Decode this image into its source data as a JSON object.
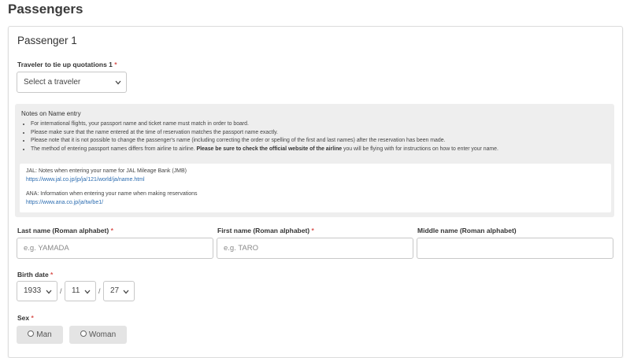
{
  "page_title": "Passengers",
  "card_title": "Passenger 1",
  "traveler": {
    "label": "Traveler to tie up quotations 1",
    "required_mark": "*",
    "selected": "Select a traveler"
  },
  "notes": {
    "title": "Notes on Name entry",
    "items": [
      "For international flights, your passport name and ticket name must match in order to board.",
      "Please make sure that the name entered at the time of reservation matches the passport name exactly.",
      "Please note that it is not possible to change the passenger's name (including correcting the order or spelling of the first and last names) after the reservation has been made."
    ],
    "item4_prefix": "The method of entering passport names differs from airline to airline. ",
    "item4_bold": "Please be sure to check the official website of the airline",
    "item4_suffix": " you will be flying with for instructions on how to enter your name.",
    "jal_head": "JAL: Notes when entering your name for JAL Mileage Bank (JMB)",
    "jal_url": "https://www.jal.co.jp/jp/ja/121/world/ja/name.html",
    "ana_head": "ANA: Information when entering your name when making reservations",
    "ana_url": "https://www.ana.co.jp/ja/tw/be1/"
  },
  "name_fields": {
    "last_label": "Last name (Roman alphabet)",
    "last_placeholder": "e.g. YAMADA",
    "first_label": "First name (Roman alphabet)",
    "first_placeholder": "e.g. TARO",
    "middle_label": "Middle name (Roman alphabet)",
    "middle_placeholder": "",
    "required_mark": "*"
  },
  "birth_date": {
    "label": "Birth date",
    "required_mark": "*",
    "year": "1933",
    "month": "11",
    "day": "27",
    "separator": "/"
  },
  "sex": {
    "label": "Sex",
    "required_mark": "*",
    "options": [
      "Man",
      "Woman"
    ]
  },
  "icons": {
    "dropdown": "chevron-down-icon",
    "radio": "radio-circle-icon"
  },
  "colors": {
    "required": "#d9534f",
    "link": "#2b6cb0",
    "notes_bg": "#eeeeee"
  }
}
